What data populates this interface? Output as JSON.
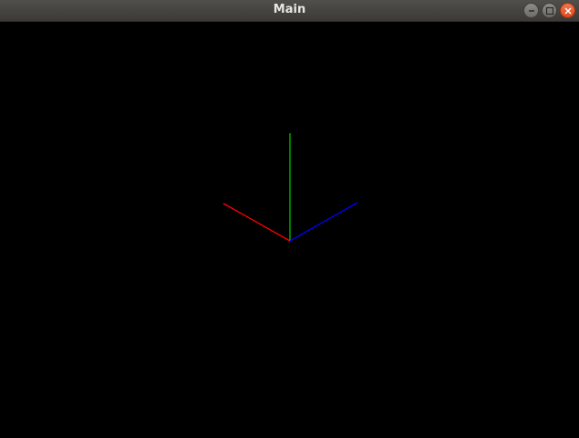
{
  "window": {
    "title": "Main",
    "controls": {
      "minimize_icon": "minimize-icon",
      "maximize_icon": "maximize-icon",
      "close_icon": "close-icon"
    }
  },
  "scene": {
    "background_color": "#000000",
    "axes": [
      {
        "name": "x-axis",
        "color": "#ff0000"
      },
      {
        "name": "y-axis",
        "color": "#00c000"
      },
      {
        "name": "z-axis",
        "color": "#0000ff"
      }
    ]
  }
}
